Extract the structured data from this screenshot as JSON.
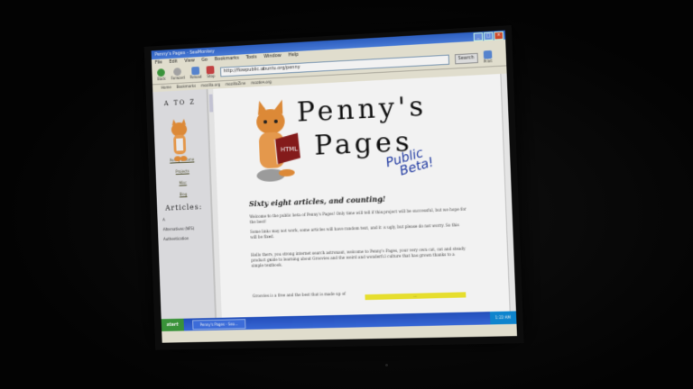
{
  "window": {
    "title": "Penny's Pages - SeaMonkey",
    "controls": [
      "_",
      "□",
      "×"
    ]
  },
  "menu": [
    "File",
    "Edit",
    "View",
    "Go",
    "Bookmarks",
    "Tools",
    "Window",
    "Help"
  ],
  "toolbar": {
    "back": "Back",
    "forward": "Forward",
    "reload": "Reload",
    "stop": "Stop",
    "url": "http://flowpublic.ubuntu.org/penny",
    "search": "Search",
    "print": "Print"
  },
  "bookmarks": [
    "Home",
    "Bookmarks",
    "mozilla.org",
    "mozillaZine",
    "mozdev.org"
  ],
  "sidebar": {
    "title": "A TO Z",
    "links": [
      "Penny's Home",
      "Projects",
      "Misc",
      "Blog"
    ],
    "articles_heading": "Articles:",
    "items": [
      "A",
      "Alternatives (NFS)",
      "Authentication"
    ]
  },
  "page": {
    "logo_line1": "Penny's",
    "logo_line2": "Pages",
    "book_label": "HTML",
    "beta_line1": "Public",
    "beta_line2": "Beta!",
    "headline": "Sixty eight articles, and counting!",
    "para1": "Welcome to the public beta of Penny's Pages! Only time will tell if this project will be successful, but we hope for the best!",
    "para2": "Some links may not work, some articles will have random text, and it is ugly, but please do not worry. So this will be fixed.",
    "para3": "Hello there, you strong internet search astronaut, welcome to Penny's Pages, your very own cat, cat and steady product guide to learning about Groovies and the weird and wonderful culture that has grown thanks to a simple textbook.",
    "para4": "Groovies is a free and the best that is made up of",
    "highlight": "..."
  },
  "taskbar": {
    "start": "start",
    "active_item": "Penny's Pages - Sea...",
    "clock": "1:22 AM"
  }
}
